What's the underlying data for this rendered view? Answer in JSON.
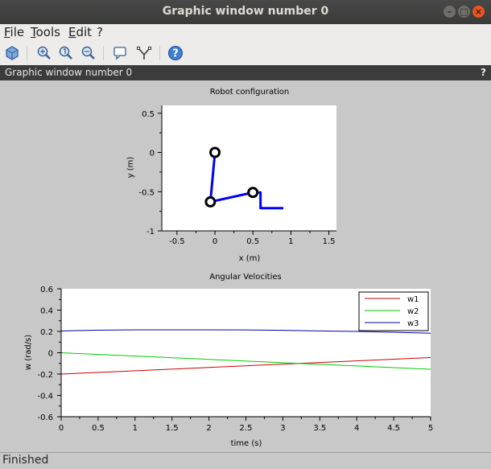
{
  "window": {
    "title": "Graphic window number 0",
    "subtitle": "Graphic window number 0",
    "help_glyph": "?"
  },
  "window_buttons": [
    {
      "icon": "minimize-icon",
      "glyph": "–"
    },
    {
      "icon": "maximize-icon",
      "glyph": "□"
    },
    {
      "icon": "close-icon",
      "glyph": "×"
    }
  ],
  "menu": [
    "File",
    "Tools",
    "Edit",
    "?"
  ],
  "toolbar": [
    "rotate-icon",
    "zoom-in-icon",
    "zoom-fit-icon",
    "zoom-out-icon",
    "datatip-icon",
    "editor-icon",
    "help-icon"
  ],
  "status": "Finished",
  "colors": {
    "link": "#0000ff",
    "w1": "#cc0000",
    "w2": "#00cc00",
    "w3": "#0000aa",
    "canvas": "#c8c8c8"
  },
  "chart_data": [
    {
      "type": "line",
      "title": "Robot configuration",
      "xlabel": "x (m)",
      "ylabel": "y (m)",
      "xlim": [
        -0.7,
        1.6
      ],
      "ylim": [
        -1,
        0.6
      ],
      "xticks": [
        "-0.5",
        "0",
        "0.5",
        "1",
        "1.5"
      ],
      "yticks": [
        "0.5",
        "0",
        "-0.5",
        "-1"
      ],
      "links": [
        {
          "x": [
            0.0,
            -0.06,
            0.5,
            0.6,
            0.6,
            0.9
          ],
          "y": [
            0.0,
            -0.63,
            -0.51,
            -0.51,
            -0.71,
            -0.71
          ]
        }
      ],
      "joints": [
        {
          "x": 0.0,
          "y": 0.0
        },
        {
          "x": -0.06,
          "y": -0.63
        },
        {
          "x": 0.5,
          "y": -0.51
        }
      ]
    },
    {
      "type": "line",
      "title": "Angular Velocities",
      "xlabel": "time (s)",
      "ylabel": "w (rad/s)",
      "xlim": [
        0,
        5
      ],
      "ylim": [
        -0.6,
        0.6
      ],
      "xticks": [
        "0",
        "0.5",
        "1",
        "1.5",
        "2",
        "2.5",
        "3",
        "3.5",
        "4",
        "4.5",
        "5"
      ],
      "yticks": [
        "0.6",
        "0.4",
        "0.2",
        "0",
        "-0.2",
        "-0.4",
        "-0.6"
      ],
      "legend": "top-right",
      "series": [
        {
          "name": "w1",
          "x": [
            0,
            5
          ],
          "y": [
            -0.2,
            -0.045
          ]
        },
        {
          "name": "w2",
          "x": [
            0,
            5
          ],
          "y": [
            0.0,
            -0.155
          ]
        },
        {
          "name": "w3",
          "x": [
            0,
            0.5,
            1,
            1.5,
            2,
            2.5,
            3,
            3.5,
            4,
            4.5,
            5
          ],
          "y": [
            0.205,
            0.212,
            0.215,
            0.215,
            0.215,
            0.214,
            0.21,
            0.205,
            0.2,
            0.192,
            0.183
          ]
        }
      ]
    }
  ]
}
